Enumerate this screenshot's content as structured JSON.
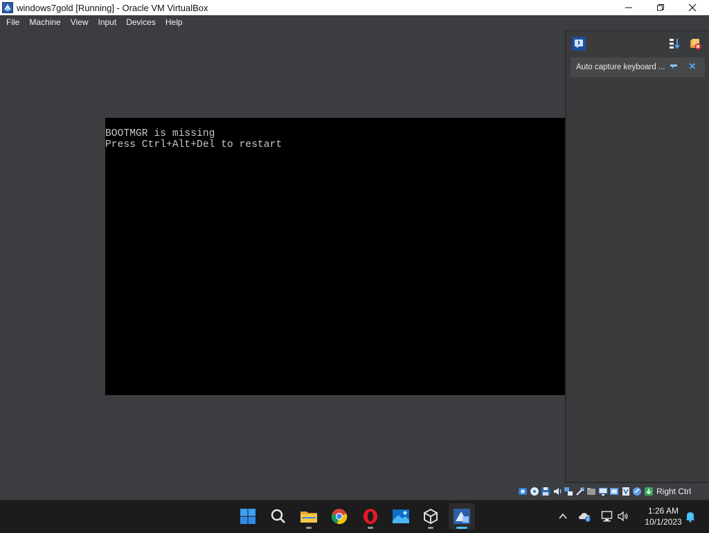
{
  "window": {
    "title": "windows7gold [Running] - Oracle VM VirtualBox",
    "icons": [
      "virtualbox-app-icon",
      "minimize-icon",
      "maximize-icon",
      "close-icon"
    ]
  },
  "menu": {
    "items": [
      "File",
      "Machine",
      "View",
      "Input",
      "Devices",
      "Help"
    ]
  },
  "vm_console": {
    "lines": [
      "BOOTMGR is missing",
      "Press Ctrl+Alt+Del to restart"
    ],
    "text_color": "#c8c8c8",
    "background": "#000000"
  },
  "notification_panel": {
    "icons": [
      "info-icon",
      "sort-icon",
      "clear-all-icon"
    ],
    "notification_text": "Auto capture keyboard ...",
    "notification_icons": [
      "expand-arrow-icon",
      "close-icon"
    ],
    "close_color": "#58a6ff"
  },
  "status_bar": {
    "icons": [
      "hard-disk-icon",
      "optical-drive-icon",
      "floppy-icon",
      "audio-icon",
      "network-icon",
      "usb-icon",
      "shared-folders-icon",
      "display-icon",
      "recording-icon",
      "cpu-icon",
      "mouse-integration-icon",
      "keyboard-capture-icon"
    ],
    "host_key": "Right Ctrl"
  },
  "taskbar": {
    "apps": [
      "start-icon",
      "search-icon",
      "file-explorer-icon",
      "chrome-icon",
      "opera-icon",
      "photos-icon",
      "virtualbox-manager-icon",
      "virtualbox-vm-icon"
    ],
    "tray_icons": [
      "chevron-up-icon",
      "onedrive-icon",
      "network-icon",
      "volume-icon",
      "notification-bell-icon"
    ],
    "time": "1:26 AM",
    "date": "10/1/2023",
    "accent": "#4cc2ff"
  }
}
